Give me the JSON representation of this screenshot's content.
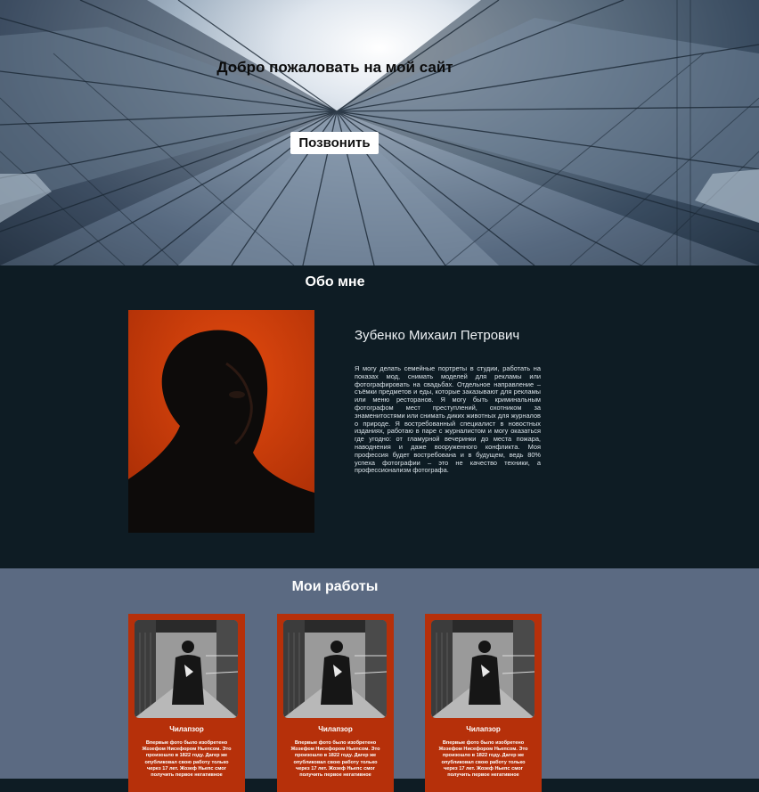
{
  "hero": {
    "title": "Добро пожаловать на мой сайт",
    "call_button": "Позвонить"
  },
  "about": {
    "heading": "Обо мне",
    "name": "Зубенко Михаил Петрович",
    "bio": "Я могу делать семейные портреты в студии, работать на показах мод, снимать моделей для рекламы или фотографировать на свадьбах. Отдельное направление – съёмки предметов и еды, которые заказывают для рекламы или меню ресторанов. Я могу быть криминальным фотографом мест преступлений, охотником за знаменитостями или снимать диких животных для журналов о природе. Я востребованный специалист в новостных изданиях, работаю в паре с журналистом и могу оказаться где угодно: от гламурной вечеринки до места пожара, наводнения и даже вооруженного конфликта. Моя профессия будет востребована и в будущем, ведь 80% успеха фотографии – это не качество техники, а профессионализм фотографа."
  },
  "works": {
    "heading": "Мои работы",
    "cards": [
      {
        "title": "Чилапзор",
        "text": "Впервые фото было изобретено Жозефом Нисефором Ньепсом. Это произошло в 1822 году. Дагер же опубликовал свою работу только через 17 лет. Жозеф Ньепс смог получить первое негативное"
      },
      {
        "title": "Чилапзор",
        "text": "Впервые фото было изобретено Жозефом Нисефором Ньепсом. Это произошло в 1822 году. Дагер же опубликовал свою работу только через 17 лет. Жозеф Ньепс смог получить первое негативное"
      },
      {
        "title": "Чилапзор",
        "text": "Впервые фото было изобретено Жозефом Нисефором Ньепсом. Это произошло в 1822 году. Дагер же опубликовал свою работу только через 17 лет. Жозеф Ньепс смог получить первое негативное"
      }
    ]
  },
  "colors": {
    "about_bg": "#0e1c24",
    "works_bg": "#5b6a82",
    "card_bg": "#b6300a",
    "portrait_bg": "#c83a0c"
  }
}
